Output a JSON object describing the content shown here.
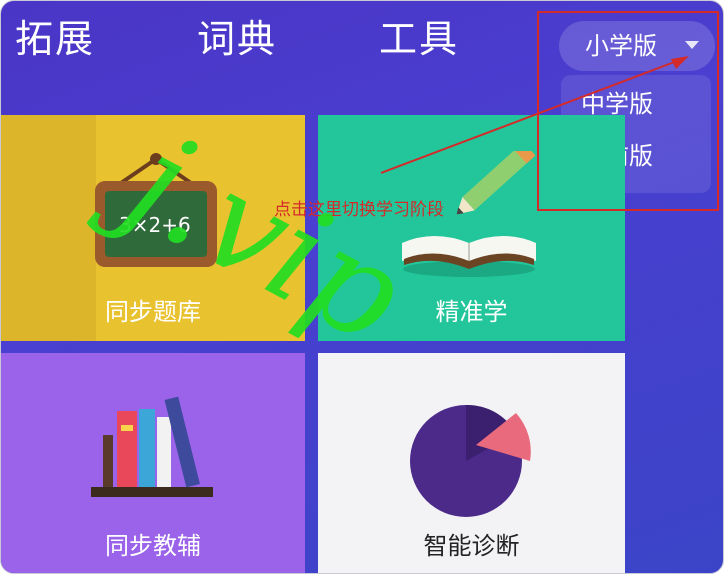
{
  "nav": {
    "tabs": [
      "拓展",
      "词典",
      "工具"
    ],
    "level_selected": "小学版",
    "level_options": [
      "中学版",
      "学前版"
    ]
  },
  "cards": [
    {
      "label": "同步题库",
      "board_text": "3×2+6"
    },
    {
      "label": "精准学"
    },
    {
      "label": "同步教辅"
    },
    {
      "label": "智能诊断"
    }
  ],
  "annotation": {
    "text": "点击这里切换学习阶段"
  },
  "watermark": {
    "text": "j.vip"
  },
  "colors": {
    "background": "#4a3fd0",
    "card_yellow": "#e9c22f",
    "card_green": "#22c69a",
    "card_purple": "#9a63ea",
    "card_white": "#f3f2f5",
    "annotation_red": "#d42a2a",
    "watermark_green": "#22dd22"
  }
}
